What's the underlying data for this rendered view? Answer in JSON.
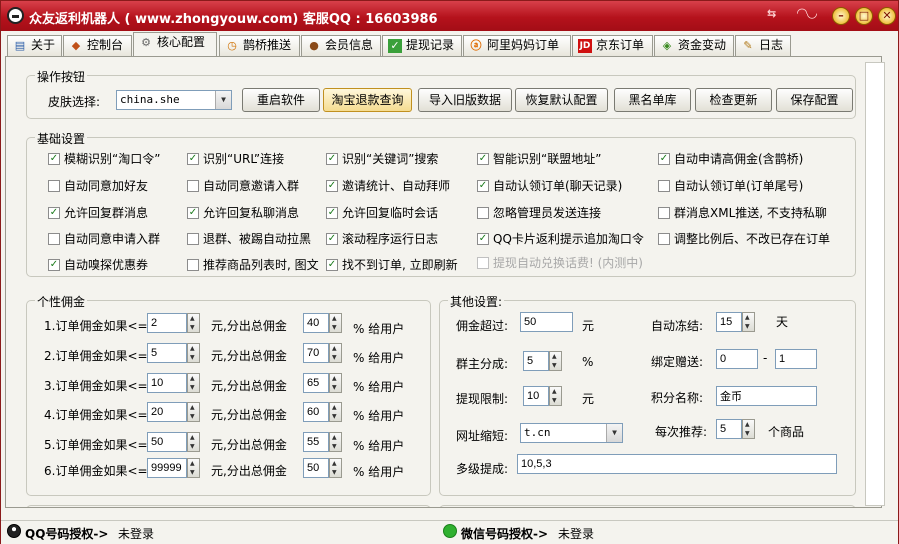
{
  "window": {
    "title": "众友返利机器人 ( www.zhongyouw.com) 客服QQ : 16603986"
  },
  "tabs": [
    {
      "label": "关于",
      "icon": "book-icon"
    },
    {
      "label": "控制台",
      "icon": "shield-icon"
    },
    {
      "label": "核心配置",
      "icon": "gear-icon"
    },
    {
      "label": "鹊桥推送",
      "icon": "clock-icon"
    },
    {
      "label": "会员信息",
      "icon": "user-icon"
    },
    {
      "label": "提现记录",
      "icon": "check-icon"
    },
    {
      "label": "阿里妈妈订单",
      "icon": "ali-icon"
    },
    {
      "label": "京东订单",
      "icon": "jd-icon"
    },
    {
      "label": "资金变动",
      "icon": "money-icon"
    },
    {
      "label": "日志",
      "icon": "notebook-icon"
    }
  ],
  "ops": {
    "group_label": "操作按钮",
    "skin_label": "皮肤选择:",
    "skin_value": "china.she",
    "buttons": [
      "重启软件",
      "淘宝退款查询",
      "导入旧版数据",
      "恢复默认配置",
      "黑名单库",
      "检查更新",
      "保存配置"
    ]
  },
  "basic": {
    "group_label": "基础设置",
    "items": [
      {
        "label": "模糊识别“淘口令”",
        "checked": true,
        "enabled": true
      },
      {
        "label": "识别“URL”连接",
        "checked": true,
        "enabled": true
      },
      {
        "label": "识别“关键词”搜索",
        "checked": true,
        "enabled": true
      },
      {
        "label": "智能识别“联盟地址”",
        "checked": true,
        "enabled": true
      },
      {
        "label": "自动申请高佣金(含鹊桥)",
        "checked": true,
        "enabled": true
      },
      {
        "label": "自动同意加好友",
        "checked": false,
        "enabled": true
      },
      {
        "label": "自动同意邀请入群",
        "checked": false,
        "enabled": true
      },
      {
        "label": "邀请统计、自动拜师",
        "checked": true,
        "enabled": true
      },
      {
        "label": "自动认领订单(聊天记录)",
        "checked": true,
        "enabled": true
      },
      {
        "label": "自动认领订单(订单尾号)",
        "checked": false,
        "enabled": true
      },
      {
        "label": "允许回复群消息",
        "checked": true,
        "enabled": true
      },
      {
        "label": "允许回复私聊消息",
        "checked": true,
        "enabled": true
      },
      {
        "label": "允许回复临时会话",
        "checked": true,
        "enabled": true
      },
      {
        "label": "忽略管理员发送连接",
        "checked": false,
        "enabled": true
      },
      {
        "label": "群消息XML推送, 不支持私聊",
        "checked": false,
        "enabled": true
      },
      {
        "label": "自动同意申请入群",
        "checked": false,
        "enabled": true
      },
      {
        "label": "退群、被踢自动拉黑",
        "checked": false,
        "enabled": true
      },
      {
        "label": "滚动程序运行日志",
        "checked": true,
        "enabled": true
      },
      {
        "label": "QQ卡片返利提示追加淘口令",
        "checked": true,
        "enabled": true
      },
      {
        "label": "调整比例后、不改已存在订单",
        "checked": false,
        "enabled": true
      },
      {
        "label": "自动嗅探优惠券",
        "checked": true,
        "enabled": true
      },
      {
        "label": "推荐商品列表时, 图文",
        "checked": false,
        "enabled": true
      },
      {
        "label": "找不到订单, 立即刷新",
        "checked": true,
        "enabled": true
      },
      {
        "label": "提现自动兑换话费! (内测中)",
        "checked": false,
        "enabled": false
      }
    ]
  },
  "personal": {
    "group_label": "个性佣金",
    "mid_label": "元,分出总佣金",
    "suffix": "% 给用户",
    "rows": [
      {
        "label": "1.订单佣金如果<=",
        "amount": "2",
        "percent": "40"
      },
      {
        "label": "2.订单佣金如果<=",
        "amount": "5",
        "percent": "70"
      },
      {
        "label": "3.订单佣金如果<=",
        "amount": "10",
        "percent": "65"
      },
      {
        "label": "4.订单佣金如果<=",
        "amount": "20",
        "percent": "60"
      },
      {
        "label": "5.订单佣金如果<=",
        "amount": "50",
        "percent": "55"
      },
      {
        "label": "6.订单佣金如果<=",
        "amount": "99999",
        "percent": "50"
      }
    ]
  },
  "other": {
    "group_label": "其他设置:",
    "commission_over_label": "佣金超过:",
    "commission_over_value": "50",
    "yuan": "元",
    "auto_freeze_label": "自动冻结:",
    "auto_freeze_value": "15",
    "days": "天",
    "group_owner_label": "群主分成:",
    "group_owner_value": "5",
    "percent_sign": "%",
    "bind_gift_label": "绑定赠送:",
    "bind_gift_min": "0",
    "dash": "-",
    "bind_gift_max": "1",
    "withdraw_limit_label": "提现限制:",
    "withdraw_limit_value": "10",
    "points_name_label": "积分名称:",
    "points_name_value": "金币",
    "url_short_label": "网址缩短:",
    "url_short_value": "t.cn",
    "per_recommend_label": "每次推荐:",
    "per_recommend_value": "5",
    "per_recommend_unit": "个商品",
    "multi_level_label": "多级提成:",
    "multi_level_value": "10,5,3"
  },
  "status": {
    "qq_label": "QQ号码授权->",
    "qq_value": "未登录",
    "wx_label": "微信号码授权->",
    "wx_value": "未登录"
  }
}
